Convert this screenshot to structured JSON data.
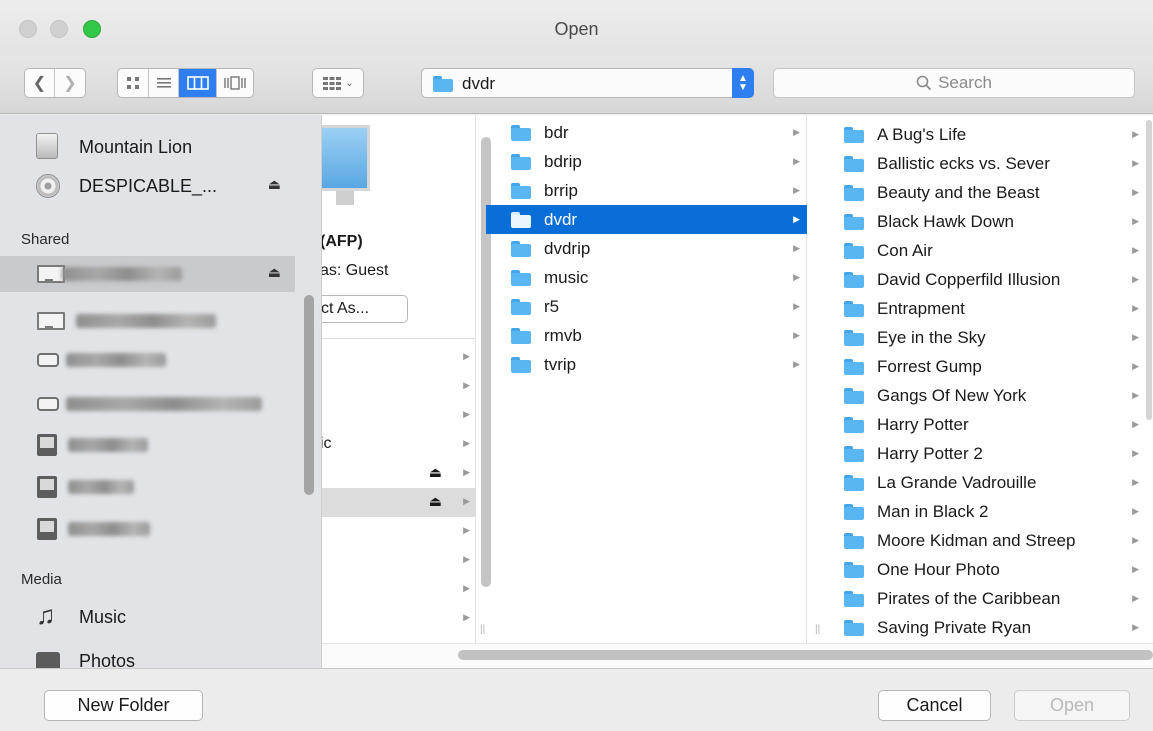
{
  "window": {
    "title": "Open"
  },
  "toolbar": {
    "view_icons": [
      "icon-view-icon",
      "list-view-icon",
      "column-view-icon",
      "cover-flow-view-icon"
    ],
    "path_popup": "dvdr",
    "search_placeholder": "Search"
  },
  "sidebar": {
    "devices": [
      {
        "label": "Mountain Lion",
        "icon": "hard-drive-icon"
      },
      {
        "label": "DESPICABLE_...",
        "icon": "disc-icon"
      }
    ],
    "shared_heading": "Shared",
    "media_heading": "Media",
    "media": [
      {
        "label": "Music",
        "icon": "music-note-icon"
      },
      {
        "label": "Photos",
        "icon": "camera-icon"
      }
    ]
  },
  "server_column": {
    "protocol": "(AFP)",
    "connected_as": "as: Guest",
    "connect_as_button": "ct As...",
    "partial_item": "ic"
  },
  "folders": {
    "items": [
      "bdr",
      "bdrip",
      "brrip",
      "dvdr",
      "dvdrip",
      "music",
      "r5",
      "rmvb",
      "tvrip"
    ],
    "selected": "dvdr"
  },
  "movies": {
    "items": [
      "A Bug's Life",
      "Ballistic ecks vs. Sever",
      "Beauty and the Beast",
      "Black Hawk Down",
      "Con Air",
      "David Copperfild Illusion",
      "Entrapment",
      "Eye in the Sky",
      "Forrest Gump",
      "Gangs Of New York",
      "Harry Potter",
      "Harry Potter 2",
      "La Grande Vadrouille",
      "Man in Black 2",
      "Moore Kidman and Streep",
      "One Hour Photo",
      "Pirates of the Caribbean",
      "Saving Private Ryan"
    ]
  },
  "buttons": {
    "new_folder": "New Folder",
    "cancel": "Cancel",
    "open": "Open"
  },
  "colors": {
    "selection": "#0a6ed8",
    "accent": "#2f7ef0",
    "folder": "#5ab6f1"
  }
}
